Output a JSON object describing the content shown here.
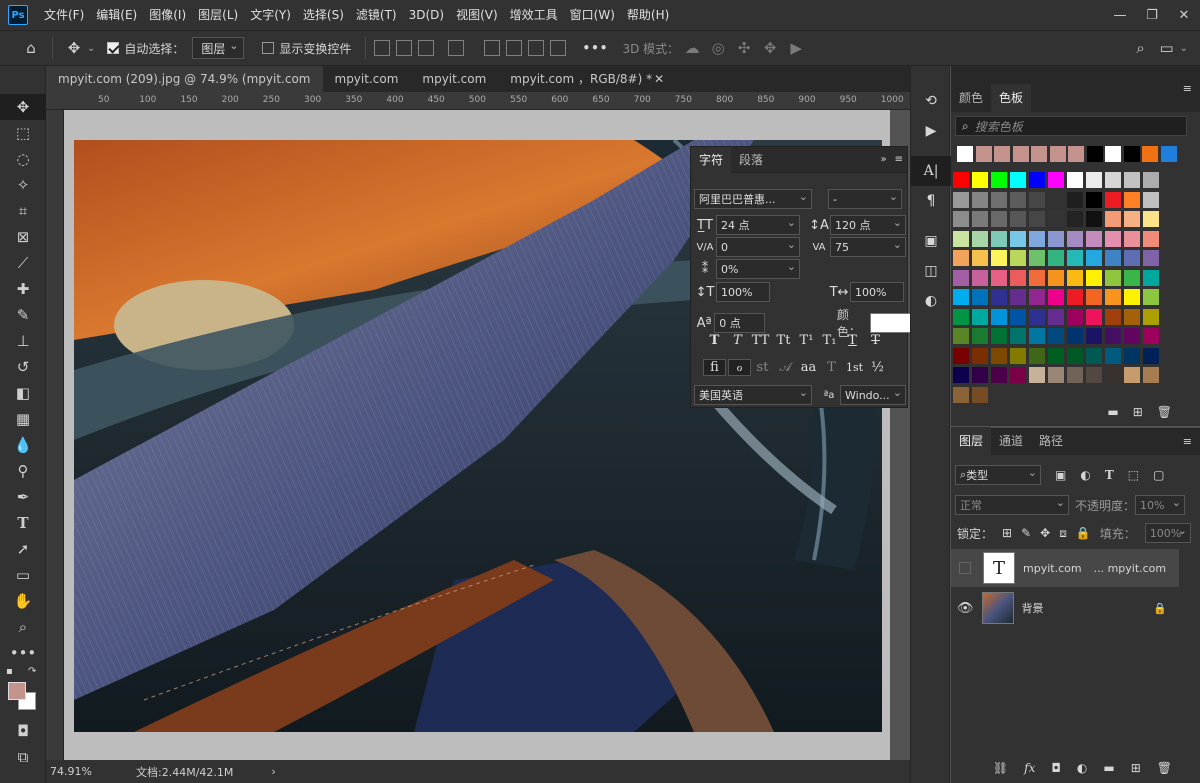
{
  "app": {
    "logo": "Ps"
  },
  "menubar": {
    "items": [
      "文件(F)",
      "编辑(E)",
      "图像(I)",
      "图层(L)",
      "文字(Y)",
      "选择(S)",
      "滤镜(T)",
      "3D(D)",
      "视图(V)",
      "增效工具",
      "窗口(W)",
      "帮助(H)"
    ],
    "window_controls": [
      "—",
      "❐",
      "✕"
    ]
  },
  "options": {
    "auto_select_label": "自动选择：",
    "auto_select_value": "图层",
    "show_transform_label": "显示变换控件",
    "more": "•••",
    "mode_3d_label": "3D 模式："
  },
  "tabs": [
    {
      "label": "mpyit.com (209).jpg @ 74.9% (mpyit.com",
      "active": true
    },
    {
      "label": "mpyit.com",
      "active": false
    },
    {
      "label": "mpyit.com",
      "active": false
    },
    {
      "label": "mpyit.com ，RGB/8#) *",
      "active": false
    },
    {
      "label": "✕",
      "active": false
    }
  ],
  "ruler": {
    "h_labels": [
      "50",
      "100",
      "150",
      "200",
      "250",
      "300",
      "350",
      "400",
      "450",
      "500",
      "550",
      "600",
      "650",
      "700",
      "750",
      "800",
      "850",
      "900",
      "950",
      "1000",
      "1050"
    ]
  },
  "status": {
    "zoom": "74.91%",
    "doc": "文档:2.44M/42.1M",
    "arrow": "›"
  },
  "character": {
    "tabs": [
      "字符",
      "段落"
    ],
    "font_family": "阿里巴巴普惠...",
    "font_style": "-",
    "font_size": "24 点",
    "leading": "120 点",
    "kerning": "0",
    "tracking": "75",
    "tsume": "0%",
    "vscale": "100%",
    "hscale": "100%",
    "baseline": "0 点",
    "color_label": "颜色：",
    "color": "#ffffff",
    "style_buttons": [
      "T",
      "T",
      "TT",
      "Tt",
      "T¹",
      "T₁",
      "T",
      "T"
    ],
    "ot_buttons": [
      "fi",
      "ℴ",
      "st",
      "𝒜",
      "aa",
      "T",
      "1st",
      "½"
    ],
    "language": "美国英语",
    "aa_label": "ªa",
    "aa_value": "Windo..."
  },
  "swatches": {
    "tabs": [
      "颜色",
      "色板"
    ],
    "search_placeholder": "搜索色板",
    "recent": [
      "#ffffff",
      "#c4938d",
      "#c4938d",
      "#c4938d",
      "#c4938d",
      "#c4938d",
      "#c4938d",
      "#000000",
      "#ffffff",
      "#000000",
      "#f07014",
      "#1f7fdc"
    ],
    "grid": [
      [
        "#ff0000",
        "#ffff00",
        "#00ff00",
        "#00ffff",
        "#0000ff",
        "#ff00ff",
        "#ffffff",
        "#ebebeb",
        "#d6d6d6",
        "#c2c2c2",
        "#adadad"
      ],
      [
        "#999999",
        "#858585",
        "#707070",
        "#5c5c5c",
        "#474747",
        "#333333",
        "#1f1f1f",
        "#000000",
        "#ed1c24",
        "#ff7f27",
        "#c0c0c0"
      ],
      [
        "#8c8c8c",
        "#7a7a7a",
        "#696969",
        "#575757",
        "#464646",
        "#343434",
        "#232323",
        "#111111",
        "#f29b76",
        "#f5b183",
        "#fbe38a"
      ],
      [
        "#c9e4a1",
        "#a6d5a8",
        "#7fc9b9",
        "#77c8e6",
        "#7fa9dc",
        "#8b97d0",
        "#a48bc1",
        "#c38cbc",
        "#e58fb0",
        "#e9909a",
        "#f18b79"
      ],
      [
        "#f3a25c",
        "#f6c04f",
        "#fdf35c",
        "#b8d75b",
        "#6fc06a",
        "#33b483",
        "#26b7b7",
        "#25a8e0",
        "#3f83c5",
        "#5f6db3",
        "#8062a8"
      ],
      [
        "#a25fa6",
        "#c6619c",
        "#e85f85",
        "#ec5c5d",
        "#f26b3a",
        "#f6921e",
        "#fbb914",
        "#fff100",
        "#8fc63e",
        "#39b54a",
        "#00a79d"
      ],
      [
        "#00aeef",
        "#0072bc",
        "#2e3192",
        "#662d91",
        "#92278f",
        "#ec008c",
        "#ed1c24",
        "#f26522",
        "#f7941d",
        "#fff200",
        "#8dc63f"
      ],
      [
        "#009444",
        "#00a99d",
        "#0095da",
        "#0054a6",
        "#2e3192",
        "#662d91",
        "#9e005d",
        "#ed145b",
        "#a0410d",
        "#a36209",
        "#aba000"
      ],
      [
        "#598527",
        "#197b30",
        "#007236",
        "#00746b",
        "#0076a3",
        "#004a80",
        "#003471",
        "#1b1464",
        "#440e62",
        "#630460",
        "#9e005d"
      ],
      [
        "#790000",
        "#7b2e00",
        "#7d4900",
        "#827b00",
        "#406618",
        "#005e20",
        "#005826",
        "#005952",
        "#005b7f",
        "#003663",
        "#002157"
      ],
      [
        "#0d004c",
        "#32004b",
        "#4b0049",
        "#7b0046",
        "#c7b299",
        "#998675",
        "#736357",
        "#534741",
        "#37302d",
        "#c69c6d",
        "#a67c52"
      ],
      [
        "#8c6239",
        "#754c24"
      ]
    ]
  },
  "layers": {
    "tabs": [
      "图层",
      "通道",
      "路径"
    ],
    "filter_label": "类型",
    "blend_mode": "正常",
    "opacity_label": "不透明度：",
    "opacity": "10%",
    "lock_label": "锁定：",
    "fill_label": "填充：",
    "fill": "100%",
    "rows": [
      {
        "name": "mpyit.com",
        "name2": "... mpyit.com",
        "type": "text",
        "visible": false
      },
      {
        "name": "背景",
        "name2": "",
        "type": "image",
        "visible": true
      }
    ]
  }
}
